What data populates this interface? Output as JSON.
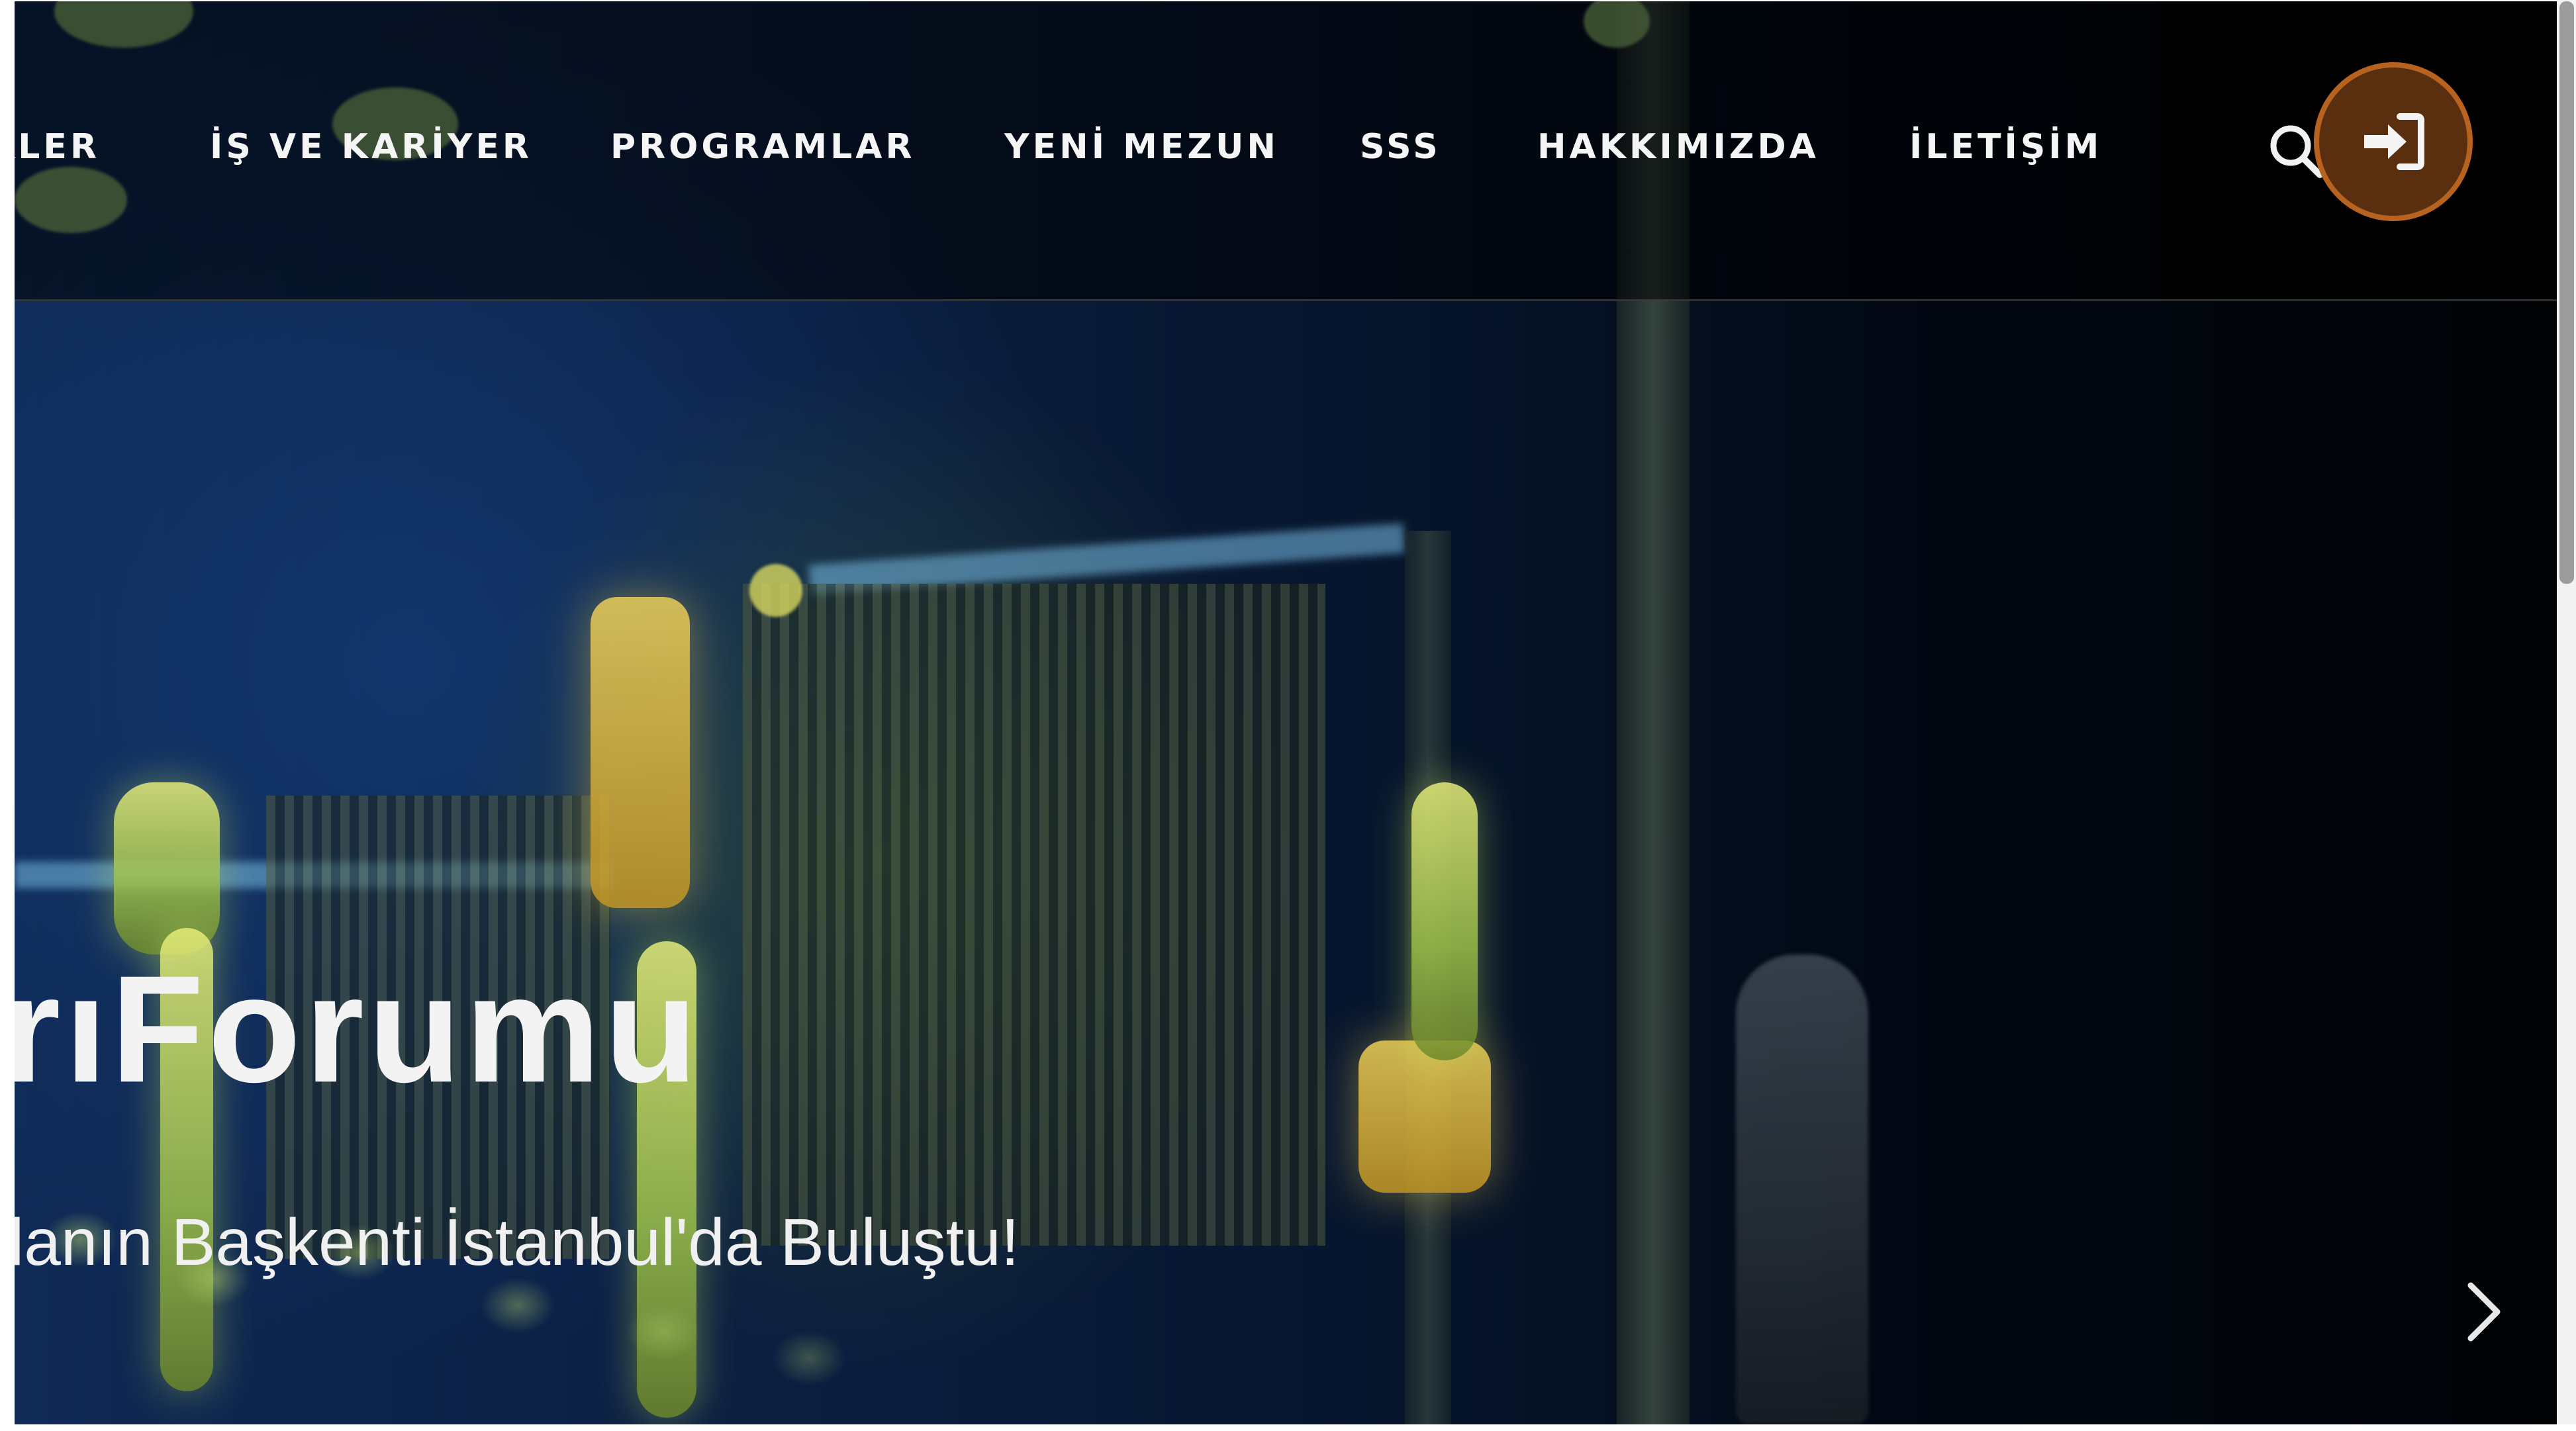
{
  "nav": {
    "items": [
      {
        "label": "KLER"
      },
      {
        "label": "İŞ VE KARİYER"
      },
      {
        "label": "PROGRAMLAR"
      },
      {
        "label": "YENİ MEZUN"
      },
      {
        "label": "SSS"
      },
      {
        "label": "HAKKIMIZDA"
      },
      {
        "label": "İLETİŞİM"
      }
    ],
    "search_icon": "search-icon",
    "login_icon": "sign-in-icon"
  },
  "hero": {
    "title": "rıForumu",
    "subtitle": "lanın Başkenti İstanbul'da Buluştu!",
    "next_icon": "chevron-right-icon"
  },
  "colors": {
    "login_button_fill": "#5a2f10",
    "login_button_border": "#b8621f",
    "nav_text": "#f5f5f5"
  }
}
